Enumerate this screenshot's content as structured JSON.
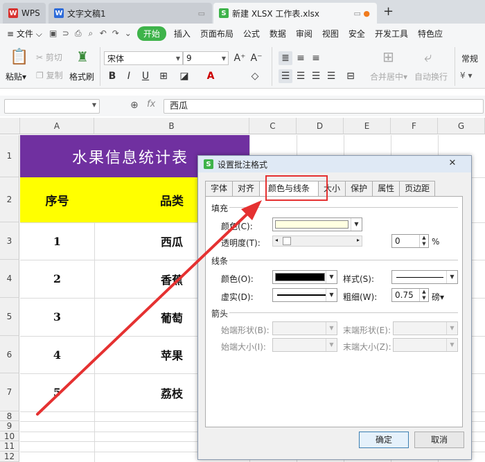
{
  "titlebar": {
    "tabs": [
      {
        "label": "WPS"
      },
      {
        "label": "文字文稿1"
      },
      {
        "label": "新建 XLSX 工作表.xlsx"
      }
    ],
    "new_tab": "+"
  },
  "menu": {
    "file": "文件",
    "start": "开始",
    "items": [
      "插入",
      "页面布局",
      "公式",
      "数据",
      "审阅",
      "视图",
      "安全",
      "开发工具",
      "特色应"
    ]
  },
  "ribbon": {
    "paste": "粘贴",
    "cut": "剪切",
    "copy": "复制",
    "format_painter": "格式刷",
    "font_name": "宋体",
    "font_size": "9",
    "merge_center": "合并居中",
    "wrap_text": "自动换行",
    "number_format": "常规"
  },
  "formula_bar": {
    "name_box": "",
    "formula": "西瓜"
  },
  "sheet": {
    "columns": [
      "A",
      "B",
      "C",
      "D",
      "E",
      "F",
      "G"
    ],
    "rows": [
      "1",
      "2",
      "3",
      "4",
      "5",
      "6",
      "7",
      "8",
      "9",
      "10",
      "11",
      "12"
    ],
    "title": "水果信息统计表",
    "header": {
      "no": "序号",
      "category": "品类"
    },
    "data": [
      {
        "no": "1",
        "category": "西瓜"
      },
      {
        "no": "2",
        "category": "香蕉"
      },
      {
        "no": "3",
        "category": "葡萄"
      },
      {
        "no": "4",
        "category": "苹果"
      },
      {
        "no": "5",
        "category": "荔枝"
      }
    ]
  },
  "dialog": {
    "title": "设置批注格式",
    "tabs": [
      "字体",
      "对齐",
      "颜色与线条",
      "大小",
      "保护",
      "属性",
      "页边距"
    ],
    "fill": {
      "section": "填充",
      "color_label": "颜色(C):",
      "transparency_label": "透明度(T):",
      "transparency_value": "0",
      "transparency_unit": "%",
      "color": "#ffffe1"
    },
    "line": {
      "section": "线条",
      "color_label": "颜色(O):",
      "style_label": "样式(S):",
      "dash_label": "虚实(D):",
      "weight_label": "粗细(W):",
      "weight_value": "0.75",
      "weight_unit": "磅",
      "color": "#000000"
    },
    "arrows": {
      "section": "箭头",
      "begin_style": "始端形状(B):",
      "end_style": "末端形状(E):",
      "begin_size": "始端大小(I):",
      "end_size": "末端大小(Z):"
    },
    "ok": "确定",
    "cancel": "取消"
  },
  "colors": {
    "title_fill": "#7030a0",
    "header_fill": "#ffff00",
    "accent_green": "#3eb34a",
    "arrow_red": "#e53131"
  }
}
